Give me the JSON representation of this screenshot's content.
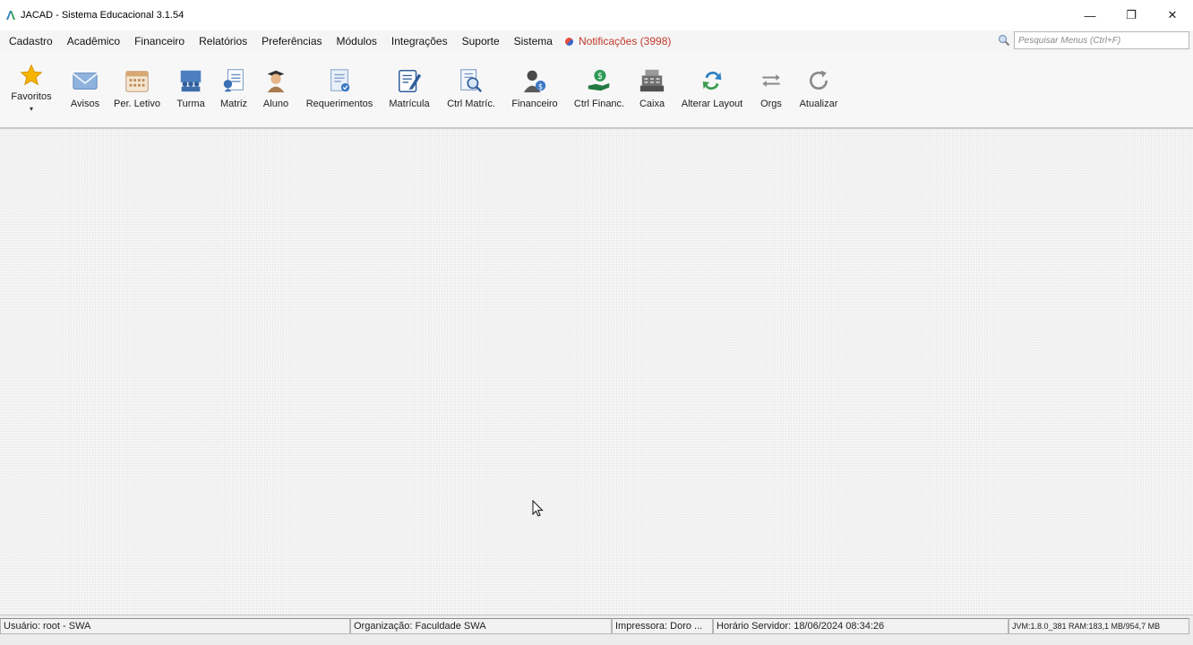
{
  "window": {
    "title": "JACAD - Sistema Educacional 3.1.54",
    "minimize": "—",
    "restore": "❐",
    "close": "✕"
  },
  "menu": {
    "items": [
      {
        "label": "Cadastro"
      },
      {
        "label": "Acadêmico"
      },
      {
        "label": "Financeiro"
      },
      {
        "label": "Relatórios"
      },
      {
        "label": "Preferências"
      },
      {
        "label": "Módulos"
      },
      {
        "label": "Integrações"
      },
      {
        "label": "Suporte"
      },
      {
        "label": "Sistema"
      }
    ],
    "notifications": "Notificações (3998)",
    "search_placeholder": "Pesquisar Menus (Ctrl+F)"
  },
  "toolbar": {
    "items": [
      {
        "label": "Favoritos",
        "icon": "star-icon"
      },
      {
        "label": "Avisos",
        "icon": "envelope-icon"
      },
      {
        "label": "Per. Letivo",
        "icon": "calendar-icon"
      },
      {
        "label": "Turma",
        "icon": "class-group-icon"
      },
      {
        "label": "Matriz",
        "icon": "matrix-document-icon"
      },
      {
        "label": "Aluno",
        "icon": "student-icon"
      },
      {
        "label": "Requerimentos",
        "icon": "request-document-icon"
      },
      {
        "label": "Matrícula",
        "icon": "enrollment-edit-icon"
      },
      {
        "label": "Ctrl Matríc.",
        "icon": "enrollment-search-icon"
      },
      {
        "label": "Financeiro",
        "icon": "finance-person-icon"
      },
      {
        "label": "Ctrl Financ.",
        "icon": "money-hand-icon"
      },
      {
        "label": "Caixa",
        "icon": "cash-register-icon"
      },
      {
        "label": "Alterar Layout",
        "icon": "swap-layout-icon"
      },
      {
        "label": "Orgs",
        "icon": "switch-arrows-icon"
      },
      {
        "label": "Atualizar",
        "icon": "refresh-icon"
      }
    ],
    "favorites_caret": "▾"
  },
  "status": {
    "user": "Usuário: root - SWA",
    "organization": "Organização: Faculdade SWA",
    "printer": "Impressora: Doro ...",
    "server_time": "Horário Servidor: 18/06/2024 08:34:26",
    "jvm": "JVM:1.8.0_381  RAM:183,1 MB/954,7 MB"
  },
  "colors": {
    "notification": "#c0392b",
    "accent_blue": "#3a66c9",
    "star": "#f5b400"
  }
}
